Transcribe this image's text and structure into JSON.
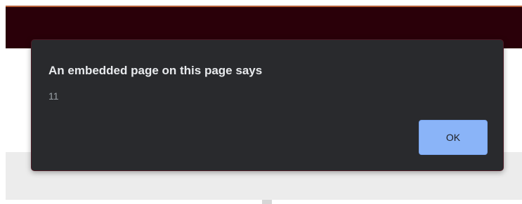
{
  "dialog": {
    "title": "An embedded page on this page says",
    "message": "11",
    "ok_label": "OK"
  },
  "colors": {
    "header_bg": "#2a0009",
    "dialog_bg": "#292a2d",
    "ok_button_bg": "#8ab4f8"
  }
}
